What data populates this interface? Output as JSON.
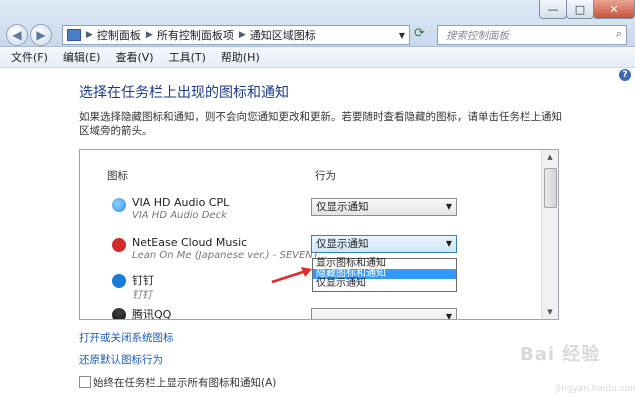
{
  "window_controls": {
    "minimize": "—",
    "maximize": "□",
    "close": "✕"
  },
  "nav": {
    "back": "◀",
    "forward": "▶"
  },
  "address": {
    "segments": [
      "控制面板",
      "所有控制面板项",
      "通知区域图标"
    ]
  },
  "search": {
    "placeholder": "搜索控制面板"
  },
  "menu": [
    "文件(F)",
    "编辑(E)",
    "查看(V)",
    "工具(T)",
    "帮助(H)"
  ],
  "main": {
    "heading": "选择在任务栏上出现的图标和通知",
    "description": "如果选择隐藏图标和通知，则不会向您通知更改和更新。若要随时查看隐藏的图标，请单击任务栏上通知区域旁的箭头。",
    "column_icon": "图标",
    "column_behavior": "行为",
    "rows": [
      {
        "name": "VIA HD Audio CPL",
        "sub": "VIA HD Audio Deck",
        "behavior": "仅显示通知",
        "icon_color": "#2f8fd6"
      },
      {
        "name": "NetEase Cloud Music",
        "sub": "Lean On Me (Japanese ver.) - SEVENT...",
        "behavior": "仅显示通知",
        "icon_color": "#d42a2a"
      },
      {
        "name": "钉钉",
        "sub": "钉钉",
        "behavior": "",
        "icon_color": "#1a7ad4"
      },
      {
        "name": "腾讯QQ",
        "sub": "",
        "behavior": "",
        "icon_color": "#222222"
      }
    ],
    "dropdown_options": [
      "显示图标和通知",
      "隐藏图标和通知",
      "仅显示通知"
    ],
    "link_system_icons": "打开或关闭系统图标",
    "link_restore": "还原默认图标行为",
    "always_show_label": "始终在任务栏上显示所有图标和通知(A)",
    "always_show_checked": false
  },
  "watermark": {
    "text": "Bai 经验",
    "url": "jingyan.baidu.com"
  }
}
